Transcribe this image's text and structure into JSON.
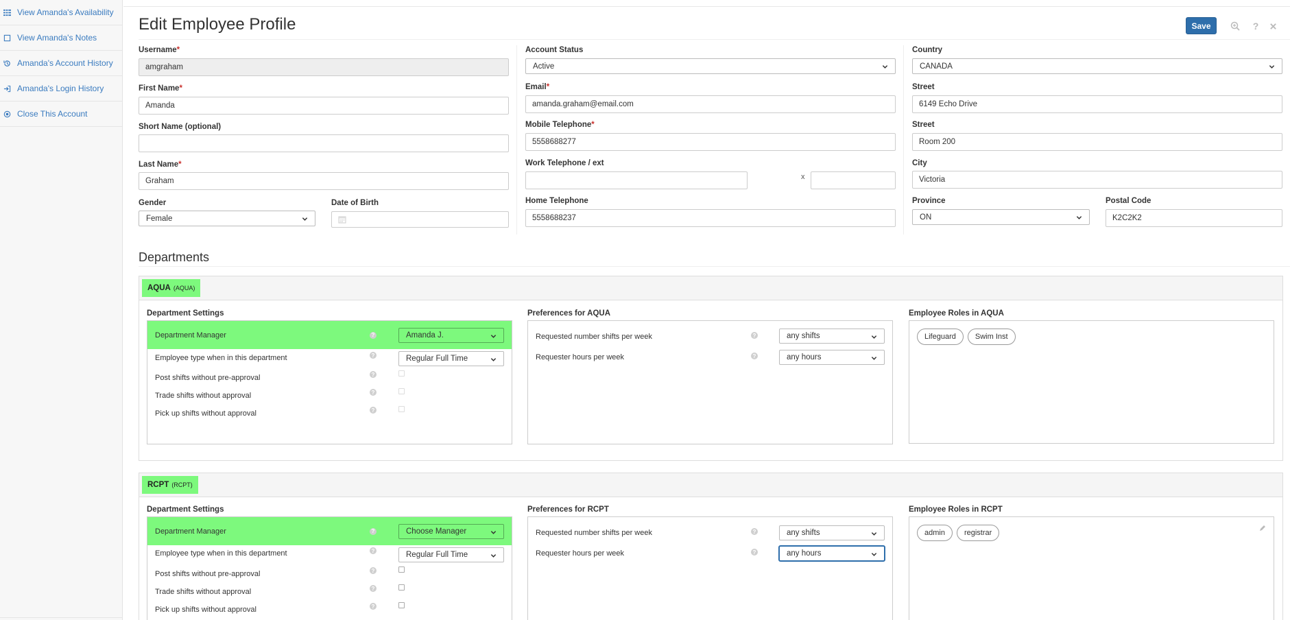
{
  "sidebar": {
    "items": [
      {
        "label": "View Amanda's Availability",
        "icon": "grid-icon"
      },
      {
        "label": "View Amanda's Notes",
        "icon": "note-icon"
      },
      {
        "label": "Amanda's Account History",
        "icon": "history-icon"
      },
      {
        "label": "Amanda's Login History",
        "icon": "login-icon"
      },
      {
        "label": "Close This Account",
        "icon": "close-circle-icon"
      }
    ]
  },
  "header": {
    "title": "Edit Employee Profile",
    "save_label": "Save",
    "icons": [
      "zoom-icon",
      "help-icon",
      "close-icon"
    ]
  },
  "profile": {
    "username": {
      "label": "Username",
      "value": "amgraham"
    },
    "first_name": {
      "label": "First Name",
      "value": "Amanda"
    },
    "short_name": {
      "label": "Short Name (optional)",
      "value": ""
    },
    "last_name": {
      "label": "Last Name",
      "value": "Graham"
    },
    "gender": {
      "label": "Gender",
      "value": "Female"
    },
    "dob": {
      "label": "Date of Birth",
      "value": ""
    },
    "account_status": {
      "label": "Account Status",
      "value": "Active"
    },
    "email": {
      "label": "Email",
      "value": "amanda.graham@email.com"
    },
    "mobile": {
      "label": "Mobile Telephone",
      "value": "5558688277"
    },
    "work_phone": {
      "label": "Work Telephone / ext",
      "value": "",
      "ext_sep": "x",
      "ext": ""
    },
    "home_phone": {
      "label": "Home Telephone",
      "value": "5558688237"
    },
    "country": {
      "label": "Country",
      "value": "CANADA"
    },
    "street1": {
      "label": "Street",
      "value": "6149 Echo Drive"
    },
    "street2": {
      "label": "Street",
      "value": "Room 200"
    },
    "city": {
      "label": "City",
      "value": "Victoria"
    },
    "province": {
      "label": "Province",
      "value": "ON"
    },
    "postal": {
      "label": "Postal Code",
      "value": "K2C2K2"
    },
    "required_mark": "*"
  },
  "departments": {
    "title": "Departments",
    "list": [
      {
        "name": "AQUA",
        "code": "(AQUA)",
        "settings_title": "Department Settings",
        "manager_label": "Department Manager",
        "manager_value": "Amanda J.",
        "emp_type_label": "Employee type when in this department",
        "emp_type_value": "Regular Full Time",
        "post_label": "Post shifts without pre-approval",
        "trade_label": "Trade shifts without approval",
        "pickup_label": "Pick up shifts without approval",
        "prefs_title": "Preferences for AQUA",
        "shifts_label": "Requested number shifts per week",
        "shifts_value": "any shifts",
        "hours_label": "Requester hours per week",
        "hours_value": "any hours",
        "roles_title": "Employee Roles in AQUA",
        "roles": [
          "Lifeguard",
          "Swim Inst"
        ]
      },
      {
        "name": "RCPT",
        "code": "(RCPT)",
        "settings_title": "Department Settings",
        "manager_label": "Department Manager",
        "manager_value": "Choose Manager",
        "emp_type_label": "Employee type when in this department",
        "emp_type_value": "Regular Full Time",
        "post_label": "Post shifts without pre-approval",
        "trade_label": "Trade shifts without approval",
        "pickup_label": "Pick up shifts without approval",
        "prefs_title": "Preferences for RCPT",
        "shifts_label": "Requested number shifts per week",
        "shifts_value": "any shifts",
        "hours_label": "Requester hours per week",
        "hours_value": "any hours",
        "roles_title": "Employee Roles in RCPT",
        "roles": [
          "admin",
          "registrar"
        ]
      }
    ]
  },
  "help_glyph": "?",
  "colors": {
    "accent": "#2e6eab",
    "link": "#3a7bbf",
    "highlight": "#7df97d",
    "required": "#c9302c"
  }
}
